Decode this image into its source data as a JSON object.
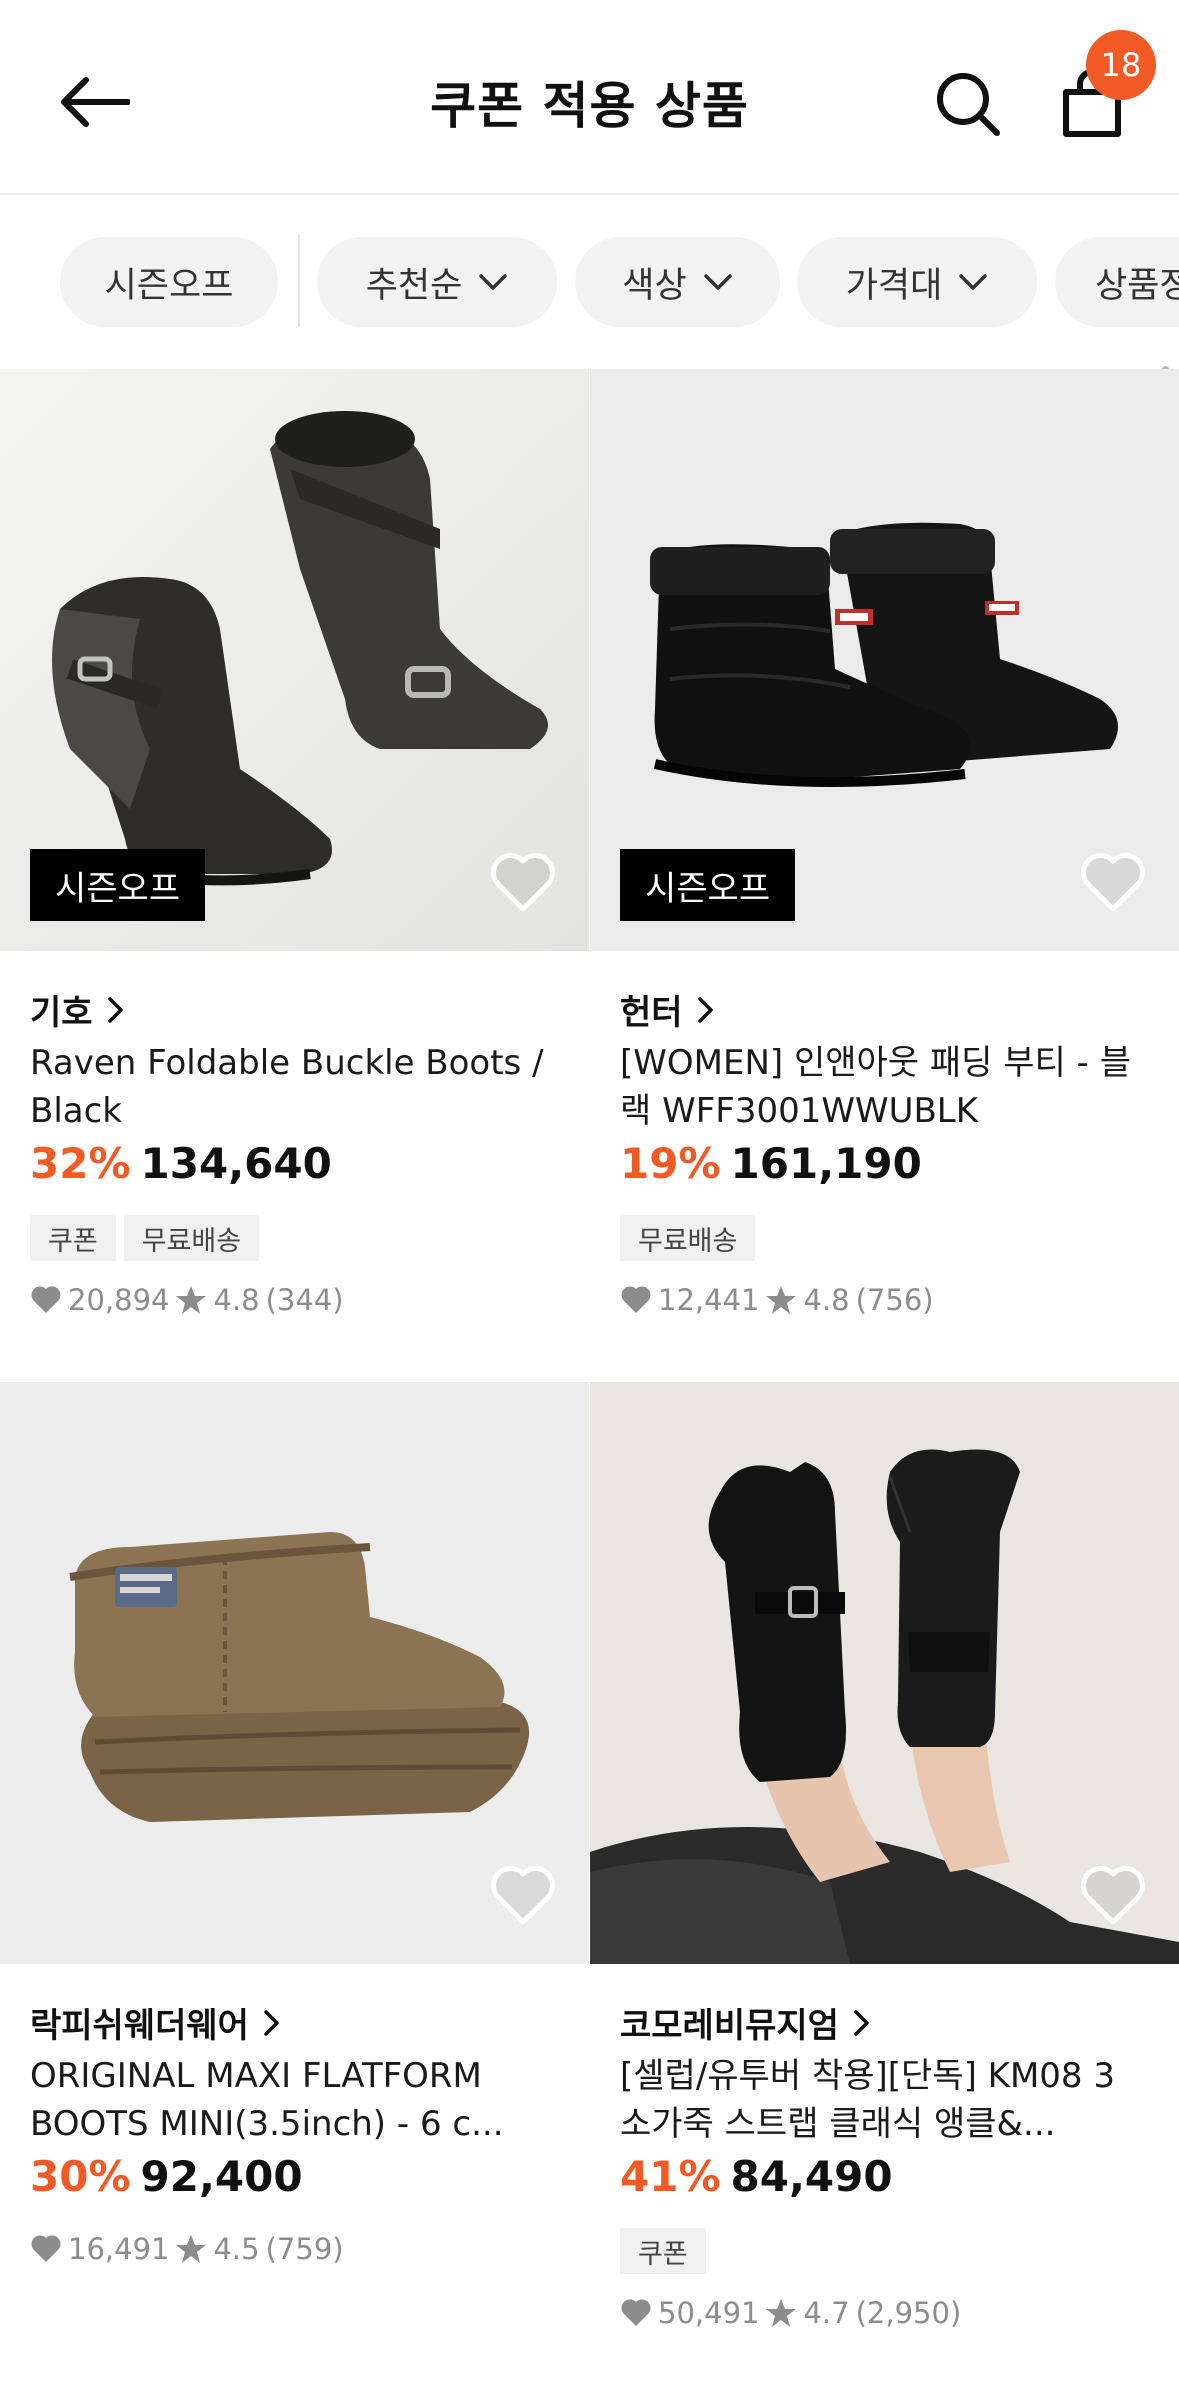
{
  "header": {
    "title": "쿠폰 적용 상품",
    "cart_count": "18"
  },
  "filters": [
    "시즌오프",
    "추천순",
    "색상",
    "가격대",
    "상품정"
  ],
  "products": [
    {
      "badge": "시즌오프",
      "brand": "기호",
      "name": "Raven Foldable Buckle Boots / Black",
      "discount": "32%",
      "price": "134,640",
      "tags": [
        "쿠폰",
        "무료배송"
      ],
      "likes": "20,894",
      "rating": "4.8",
      "reviews": "(344)"
    },
    {
      "badge": "시즌오프",
      "brand": "헌터",
      "name": "[WOMEN] 인앤아웃 패딩 부티 - 블랙 WFF3001WWUBLK",
      "discount": "19%",
      "price": "161,190",
      "tags": [
        "무료배송"
      ],
      "likes": "12,441",
      "rating": "4.8",
      "reviews": "(756)"
    },
    {
      "brand": "락피쉬웨더웨어",
      "name": "ORIGINAL MAXI FLATFORM BOOTS MINI(3.5inch) - 6 c...",
      "discount": "30%",
      "price": "92,400",
      "tags": [],
      "likes": "16,491",
      "rating": "4.5",
      "reviews": "(759)"
    },
    {
      "brand": "코모레비뮤지엄",
      "name": "[셀럽/유투버 착용][단독] KM08 3 소가죽 스트랩 클래식 앵클&...",
      "discount": "41%",
      "price": "84,490",
      "tags": [
        "쿠폰"
      ],
      "likes": "50,491",
      "rating": "4.7",
      "reviews": "(2,950)"
    }
  ],
  "colors": {
    "accent": "#f15a24",
    "badge_bg": "#000000",
    "chip_bg": "#f2f2f2"
  },
  "icons": [
    "back-arrow-icon",
    "search-icon",
    "shopping-bag-icon",
    "chevron-down-icon",
    "heart-icon",
    "star-icon",
    "chevron-right-icon"
  ]
}
